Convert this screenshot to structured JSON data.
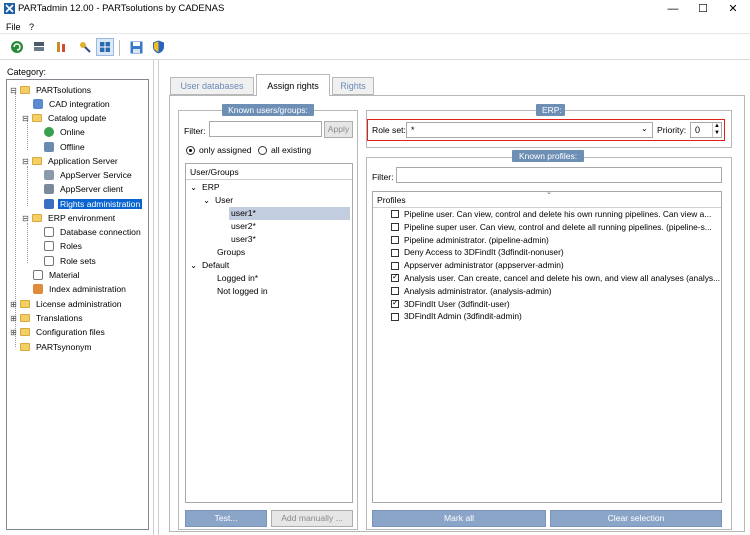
{
  "window": {
    "title": "PARTadmin 12.00 - PARTsolutions by CADENAS",
    "minimize": "—",
    "maximize": "☐",
    "close": "✕"
  },
  "menu": {
    "file": "File",
    "help": "?"
  },
  "toolbar": {
    "icons": [
      "refresh-icon",
      "server-icon",
      "tools-icon",
      "key-icon",
      "grid-icon",
      "save-icon",
      "shield-icon"
    ]
  },
  "category": {
    "label": "Category:",
    "items": [
      {
        "label": "PARTsolutions",
        "level": 0,
        "expander": "-",
        "icon": "folder"
      },
      {
        "label": "CAD integration",
        "level": 1,
        "icon": "app"
      },
      {
        "label": "Catalog update",
        "level": 1,
        "expander": "-",
        "icon": "folder"
      },
      {
        "label": "Online",
        "level": 2,
        "icon": "globe"
      },
      {
        "label": "Offline",
        "level": 2,
        "icon": "offline"
      },
      {
        "label": "Application Server",
        "level": 1,
        "expander": "-",
        "icon": "folder"
      },
      {
        "label": "AppServer Service",
        "level": 2,
        "icon": "service"
      },
      {
        "label": "AppServer client",
        "level": 2,
        "icon": "client"
      },
      {
        "label": "Rights administration",
        "level": 2,
        "icon": "rights",
        "selected": true
      },
      {
        "label": "ERP environment",
        "level": 1,
        "expander": "-",
        "icon": "folder"
      },
      {
        "label": "Database connection",
        "level": 2,
        "icon": "doc"
      },
      {
        "label": "Roles",
        "level": 2,
        "icon": "doc"
      },
      {
        "label": "Role sets",
        "level": 2,
        "icon": "doc"
      },
      {
        "label": "Material",
        "level": 1,
        "icon": "doc"
      },
      {
        "label": "Index administration",
        "level": 1,
        "icon": "index"
      },
      {
        "label": "License administration",
        "level": 0,
        "expander": "+",
        "icon": "folder"
      },
      {
        "label": "Translations",
        "level": 0,
        "expander": "+",
        "icon": "folder"
      },
      {
        "label": "Configuration files",
        "level": 0,
        "expander": "+",
        "icon": "folder"
      },
      {
        "label": "PARTsynonym",
        "level": 0,
        "icon": "folder"
      }
    ]
  },
  "tabs": {
    "user_databases": "User databases",
    "assign_rights": "Assign rights",
    "rights": "Rights"
  },
  "known_users": {
    "title": "Known users/groups:",
    "filter_label": "Filter:",
    "filter_value": "",
    "apply_button": "Apply",
    "radio_only_assigned": "only assigned",
    "radio_all_existing": "all existing",
    "list_header": "User/Groups",
    "rows": [
      {
        "label": "ERP",
        "indent": 0,
        "expander": "⌄"
      },
      {
        "label": "User",
        "indent": 1,
        "expander": "⌄"
      },
      {
        "label": "user1*",
        "indent": 2,
        "selected": true
      },
      {
        "label": "user2*",
        "indent": 2
      },
      {
        "label": "user3*",
        "indent": 2
      },
      {
        "label": "Groups",
        "indent": 1
      },
      {
        "label": "Default",
        "indent": 0,
        "expander": "⌄"
      },
      {
        "label": "Logged in*",
        "indent": 1
      },
      {
        "label": "Not logged in",
        "indent": 1
      }
    ],
    "test_button": "Test...",
    "add_manually_button": "Add manually ..."
  },
  "erp": {
    "title": "ERP:",
    "role_set_label": "Role set:",
    "role_set_value": "*",
    "priority_label": "Priority:",
    "priority_value": "0"
  },
  "known_profiles": {
    "title": "Known profiles:",
    "filter_label": "Filter:",
    "filter_value": "",
    "header": "Profiles",
    "rows": [
      {
        "label": "Pipeline user. Can view, control and delete his own running pipelines. Can view a...",
        "checked": false
      },
      {
        "label": "Pipeline super user. Can view, control and delete all running pipelines. (pipeline-s...",
        "checked": false
      },
      {
        "label": "Pipeline administrator. (pipeline-admin)",
        "checked": false
      },
      {
        "label": "Deny Access to 3DFindIt (3dfindit-nonuser)",
        "checked": false
      },
      {
        "label": "Appserver administrator (appserver-admin)",
        "checked": false
      },
      {
        "label": "Analysis user. Can create, cancel and delete his own, and view all analyses (analys...",
        "checked": true
      },
      {
        "label": "Analysis administrator. (analysis-admin)",
        "checked": false
      },
      {
        "label": "3DFindIt User (3dfindit-user)",
        "checked": true
      },
      {
        "label": "3DFindIt Admin (3dfindit-admin)",
        "checked": false
      }
    ],
    "mark_all_button": "Mark all",
    "clear_selection_button": "Clear selection"
  },
  "colors": {
    "accent": "#0a64d0",
    "group_title": "#6e8fb5",
    "highlight": "#e0201a"
  }
}
